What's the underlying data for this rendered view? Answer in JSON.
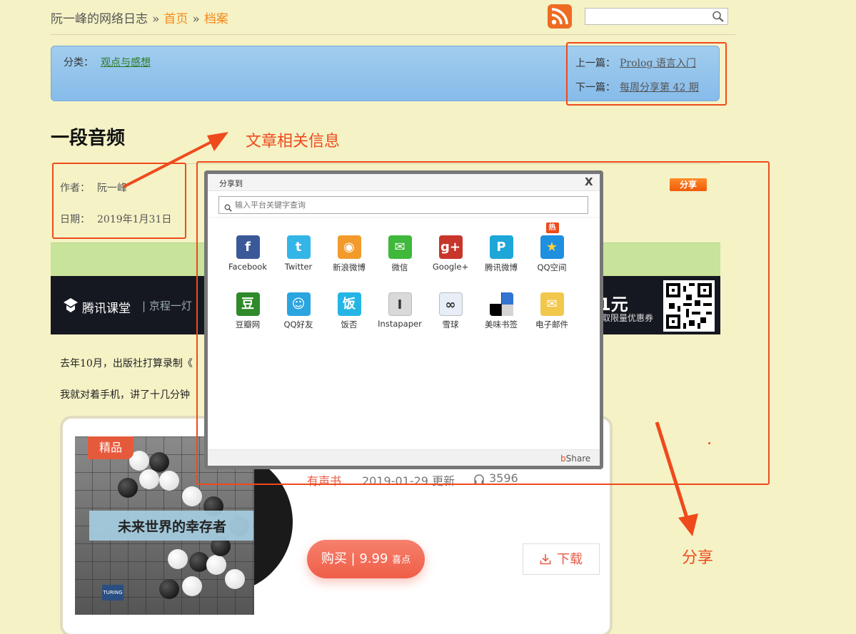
{
  "header": {
    "site_title": "阮一峰的网络日志",
    "separator": "»",
    "crumb_home": "首页",
    "crumb_archive": "档案",
    "search_placeholder": ""
  },
  "category_bar": {
    "category_label": "分类：",
    "category_value": "观点与感想",
    "prev_label": "上一篇：",
    "prev_link": "Prolog 语言入门",
    "next_label": "下一篇：",
    "next_link": "每周分享第 42 期"
  },
  "article": {
    "title": "一段音频",
    "author_label": "作者：",
    "author_value": "阮一峰",
    "date_label": "日期：",
    "date_value": "2019年1月31日",
    "share_button": "分享",
    "para1": "去年10月，出版社打算录制《",
    "para2": "我就对着手机，讲了十几分钟"
  },
  "ad_banner": {
    "logo_text": "腾讯课堂",
    "logo_sub": "|  京程一灯",
    "price_text": "1元",
    "sub_text": "取限量优惠券"
  },
  "audiobook": {
    "badge": "精品",
    "cover_title": "未来世界的幸存者",
    "cover_logo": "TURING",
    "category": "有声书",
    "updated": "2019-01-29 更新",
    "listens": "3596",
    "buy_label": "购买 | 9.99",
    "buy_unit": "喜点",
    "download_label": "下载"
  },
  "annotations": {
    "info_note": "文章相关信息",
    "share_note": "分享"
  },
  "share_dialog": {
    "title": "分享到",
    "close": "X",
    "search_placeholder": "输入平台关键字查询",
    "hot_badge": "热",
    "brand_prefix": "b",
    "brand_suffix": "Share",
    "services": [
      {
        "label": "Facebook",
        "icon": "facebook-icon",
        "color": "#3b5998",
        "glyph": "f"
      },
      {
        "label": "Twitter",
        "icon": "twitter-icon",
        "color": "#33b5e8",
        "glyph": "t"
      },
      {
        "label": "新浪微博",
        "icon": "weibo-icon",
        "color": "#f29b2c",
        "glyph": "◉"
      },
      {
        "label": "微信",
        "icon": "wechat-icon",
        "color": "#3fb83b",
        "glyph": "✉"
      },
      {
        "label": "Google+",
        "icon": "google-plus-icon",
        "color": "#c8352a",
        "glyph": "g+"
      },
      {
        "label": "腾讯微博",
        "icon": "tencent-weibo-icon",
        "color": "#1ea6d9",
        "glyph": "P"
      },
      {
        "label": "QQ空间",
        "icon": "qzone-icon",
        "color": "#1f8fe0",
        "glyph": "★"
      },
      {
        "label": "豆瓣网",
        "icon": "douban-icon",
        "color": "#2f8a2a",
        "glyph": "豆"
      },
      {
        "label": "QQ好友",
        "icon": "qq-icon",
        "color": "#2aa5e0",
        "glyph": "☺"
      },
      {
        "label": "饭否",
        "icon": "fanfou-icon",
        "color": "#24b5e5",
        "glyph": "饭"
      },
      {
        "label": "Instapaper",
        "icon": "instapaper-icon",
        "color": "#d9d9d9",
        "glyph": "I"
      },
      {
        "label": "雪球",
        "icon": "xueqiu-icon",
        "color": "#e7eef7",
        "glyph": "∞"
      },
      {
        "label": "美味书签",
        "icon": "delicious-icon",
        "color": "#ffffff",
        "glyph": ""
      },
      {
        "label": "电子邮件",
        "icon": "email-icon",
        "color": "#f2c84c",
        "glyph": "✉"
      }
    ]
  }
}
